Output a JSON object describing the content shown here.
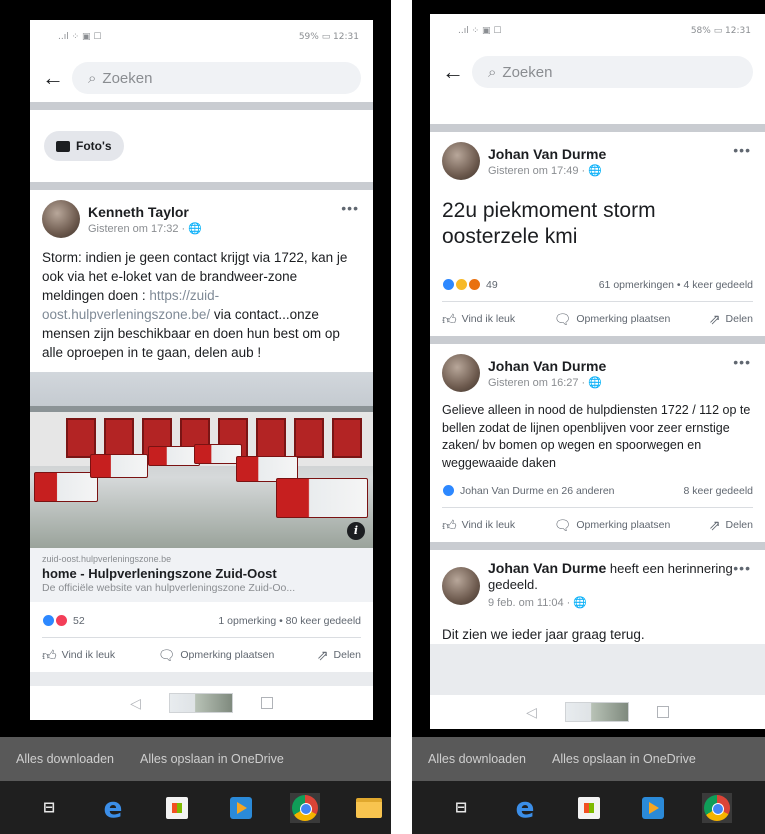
{
  "left": {
    "status": {
      "signal": "..ıl ⁘ ▣ ☐",
      "battery": "59% ▭ 12:31"
    },
    "search": {
      "placeholder": "Zoeken"
    },
    "photos_button": "Foto's",
    "post": {
      "author": "Kenneth Taylor",
      "time": "Gisteren om 17:32 · 🌐",
      "text_before_link": "Storm: indien je geen contact krijgt via 1722, kan je ook via het e-loket van de brandweer-zone meldingen doen :",
      "link_text": "https://zuid-oost.hulpverleningszone.be/",
      "text_after_link": " via contact...onze mensen zijn beschikbaar en doen hun best om op alle oproepen in te gaan, delen aub !",
      "link_domain": "zuid-oost.hulpverleningszone.be",
      "link_title": "home - Hulpverleningszone Zuid-Oost",
      "link_desc": "De officiële website van hulpverleningszone Zuid-Oo...",
      "reaction_count": "52",
      "stats": "1 opmerking • 80 keer gedeeld",
      "like": "Vind ik leuk",
      "comment": "Opmerking plaatsen",
      "share": "Delen"
    }
  },
  "right": {
    "status": {
      "signal": "..ıl ⁘ ▣ ☐",
      "battery": "58% ▭ 12:31"
    },
    "search": {
      "placeholder": "Zoeken"
    },
    "post1": {
      "author": "Johan Van Durme",
      "time": "Gisteren om 17:49 · 🌐",
      "text": "22u piekmoment storm oosterzele kmi",
      "reaction_count": "49",
      "stats": "61 opmerkingen • 4 keer gedeeld",
      "like": "Vind ik leuk",
      "comment": "Opmerking plaatsen",
      "share": "Delen"
    },
    "post2": {
      "author": "Johan Van Durme",
      "time": "Gisteren om 16:27 · 🌐",
      "text": "Gelieve alleen in nood de hulpdiensten 1722 / 112 op te bellen zodat de lijnen openblijven voor zeer ernstige zaken/ bv bomen op wegen en spoorwegen en weggewaaide daken",
      "reaction_people": "Johan Van Durme en 26 anderen",
      "stats": "8 keer gedeeld",
      "like": "Vind ik leuk",
      "comment": "Opmerking plaatsen",
      "share": "Delen"
    },
    "post3": {
      "author": "Johan Van Durme",
      "action": "heeft een herinnering gedeeld.",
      "time": "9 feb. om 11:04 · 🌐",
      "text": "Dit zien we ieder jaar graag terug."
    }
  },
  "downloads": {
    "download_all": "Alles downloaden",
    "save_onedrive": "Alles opslaan in OneDrive"
  },
  "icons": {
    "back": "←",
    "search": "🔍",
    "more": "•••",
    "like": "👍",
    "comment": "💬",
    "share": "↪",
    "nav_back": "◁"
  },
  "colors": {
    "facebook_blue": "#2d88ff",
    "love_red": "#f33e58",
    "taskbar": "#1f1f1f"
  }
}
